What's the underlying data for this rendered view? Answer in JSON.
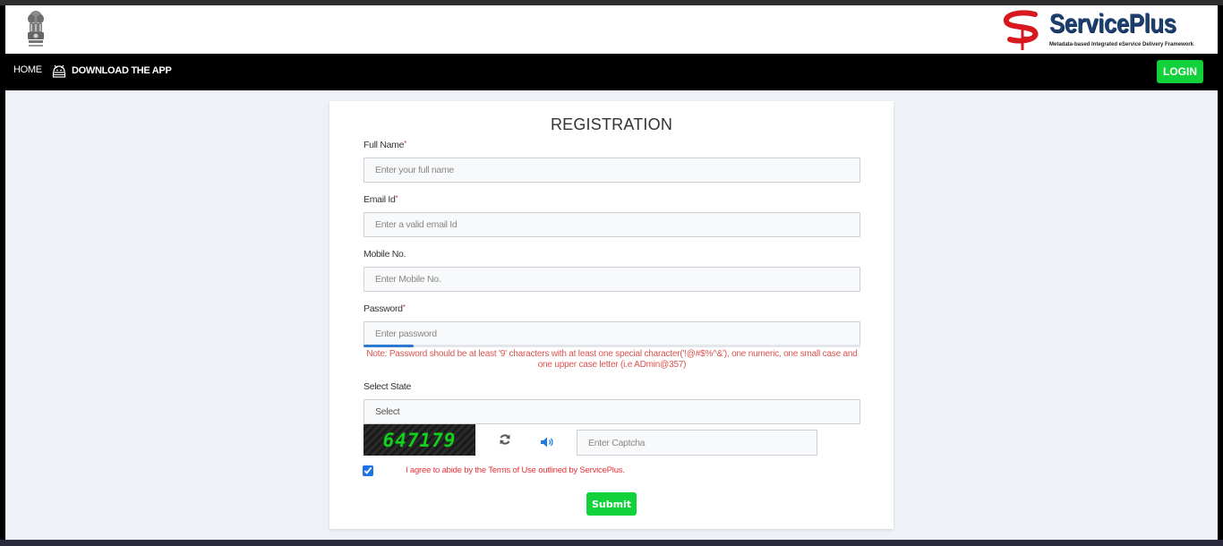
{
  "header": {
    "emblem_alt": "National Emblem of India",
    "brand_name": "ServicePlus",
    "brand_tagline": "Metadata-based Integrated eService Delivery Framework"
  },
  "nav": {
    "home_label": "HOME",
    "download_label": "DOWNLOAD THE APP",
    "download_icon": "android-icon",
    "login_label": "LOGIN"
  },
  "form": {
    "title": "REGISTRATION",
    "required_marker": "*",
    "full_name": {
      "label": "Full Name",
      "placeholder": "Enter your full name",
      "value": ""
    },
    "email": {
      "label": "Email Id",
      "placeholder": "Enter a valid email Id",
      "value": ""
    },
    "mobile": {
      "label": "Mobile No.",
      "placeholder": "Enter Mobile No.",
      "value": ""
    },
    "password": {
      "label": "Password",
      "placeholder": "Enter password",
      "value": "",
      "strength_progress_percent": 10,
      "note": "Note: Password should be at least '9' characters with at least one special character('!@#$%^&'), one numeric, one small case and one upper case letter (i.e ADmin@357)"
    },
    "state": {
      "label": "Select State",
      "selected": "Select"
    },
    "captcha": {
      "code": "647179",
      "placeholder": "Enter Captcha",
      "value": "",
      "refresh_icon": "refresh-icon",
      "audio_icon": "volume-icon"
    },
    "terms": {
      "checked": true,
      "text": "I agree to abide by the Terms of Use outlined by ServicePlus."
    },
    "submit_label": "Submit"
  },
  "colors": {
    "accent_green": "#12d23c",
    "note_red": "#d9534f",
    "brand_blue": "#1c3f6e",
    "brand_red": "#d7191f"
  }
}
